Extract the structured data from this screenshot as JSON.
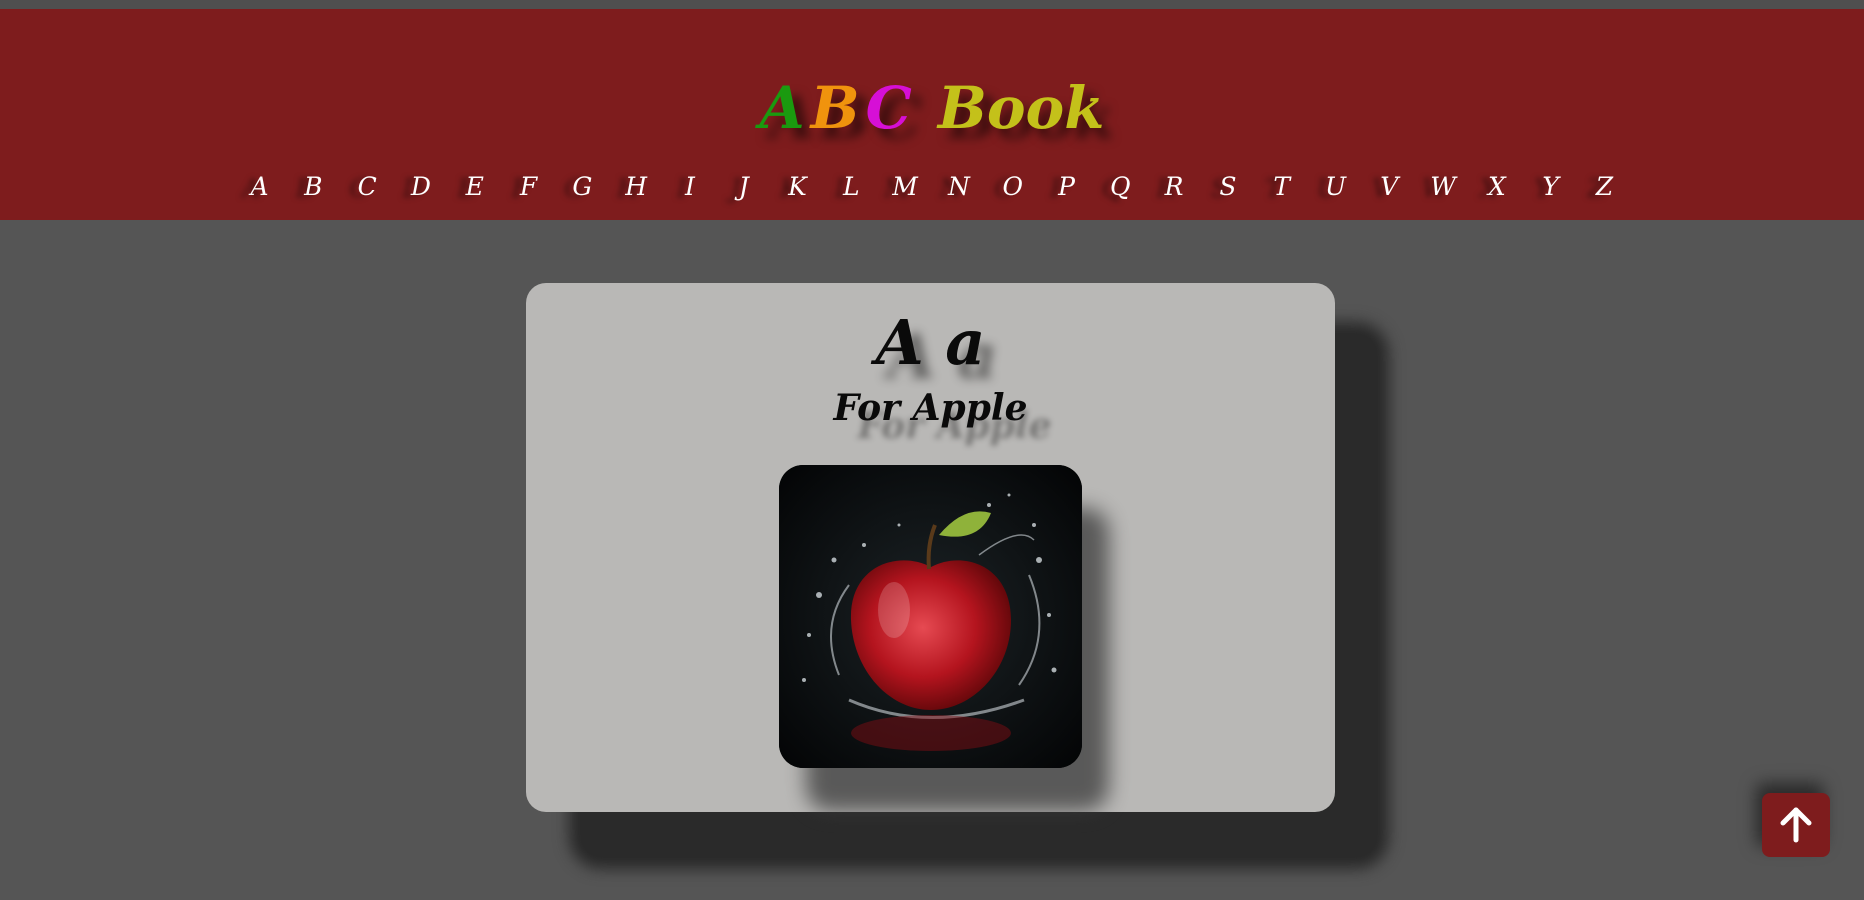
{
  "header": {
    "title_letters": [
      {
        "text": "A",
        "color": "#1a9a0f"
      },
      {
        "text": "B",
        "color": "#f0930d"
      },
      {
        "text": "C",
        "color": "#d60fd6"
      }
    ],
    "title_word": {
      "text": "Book",
      "color": "#c4c11a"
    },
    "nav_letters": [
      "A",
      "B",
      "C",
      "D",
      "E",
      "F",
      "G",
      "H",
      "I",
      "J",
      "K",
      "L",
      "M",
      "N",
      "O",
      "P",
      "Q",
      "R",
      "S",
      "T",
      "U",
      "V",
      "W",
      "X",
      "Y",
      "Z"
    ]
  },
  "card": {
    "letters": "A a",
    "word": "For Apple",
    "image_subject": "apple-splash-image"
  },
  "back_to_top": {
    "icon": "arrow-up-icon"
  },
  "colors": {
    "header_bg": "#7e1c1d",
    "page_bg": "#555555",
    "card_bg": "#b9b8b6"
  }
}
